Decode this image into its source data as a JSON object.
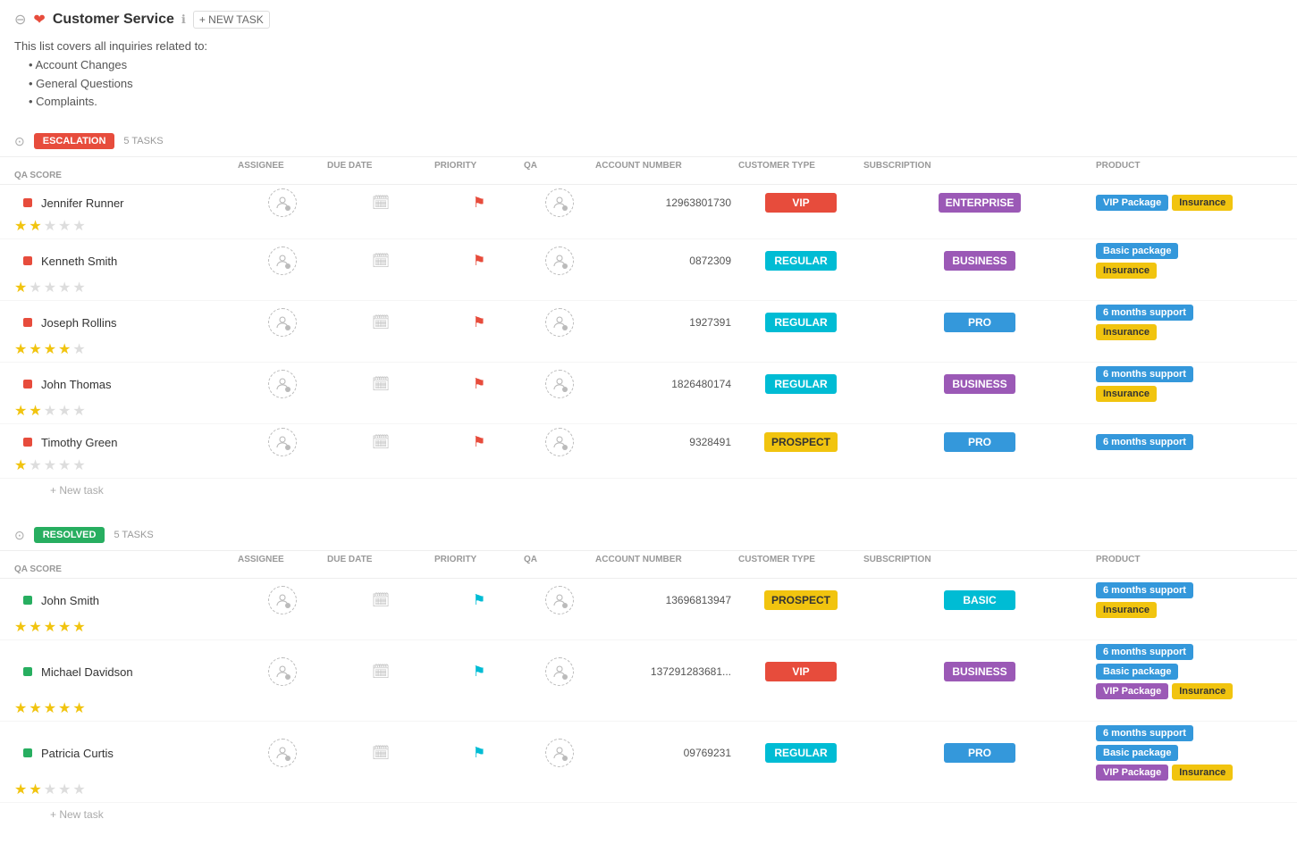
{
  "header": {
    "title": "Customer Service",
    "new_task_label": "+ NEW TASK",
    "info_tooltip": "Info"
  },
  "description": {
    "intro": "This list covers all inquiries related to:",
    "items": [
      "Account Changes",
      "General Questions",
      "Complaints."
    ]
  },
  "sections": [
    {
      "id": "escalation",
      "badge_label": "ESCALATION",
      "badge_class": "badge-escalation",
      "task_count": "5 TASKS",
      "columns": {
        "assignee": "ASSIGNEE",
        "due_date": "DUE DATE",
        "priority": "PRIORITY",
        "qa": "QA",
        "account_number": "ACCOUNT NUMBER",
        "customer_type": "CUSTOMER TYPE",
        "subscription": "SUBSCRIPTION",
        "product": "PRODUCT",
        "qa_score": "QA SCORE"
      },
      "tasks": [
        {
          "name": "Jennifer Runner",
          "account_number": "12963801730",
          "customer_type": "VIP",
          "ct_class": "ct-vip",
          "subscription": "ENTERPRISE",
          "sub_class": "sub-enterprise",
          "products": [
            {
              "label": "VIP Package",
              "class": "tag-blue"
            },
            {
              "label": "Insurance",
              "class": "tag-yellow"
            }
          ],
          "stars": 2,
          "flag_class": "flag-red"
        },
        {
          "name": "Kenneth Smith",
          "account_number": "0872309",
          "customer_type": "REGULAR",
          "ct_class": "ct-regular",
          "subscription": "BUSINESS",
          "sub_class": "sub-business",
          "products": [
            {
              "label": "Basic package",
              "class": "tag-blue"
            },
            {
              "label": "Insurance",
              "class": "tag-yellow"
            }
          ],
          "stars": 1,
          "flag_class": "flag-red"
        },
        {
          "name": "Joseph Rollins",
          "account_number": "1927391",
          "customer_type": "REGULAR",
          "ct_class": "ct-regular",
          "subscription": "PRO",
          "sub_class": "sub-pro",
          "products": [
            {
              "label": "6 months support",
              "class": "tag-blue"
            },
            {
              "label": "Insurance",
              "class": "tag-yellow"
            }
          ],
          "stars": 4,
          "flag_class": "flag-red"
        },
        {
          "name": "John Thomas",
          "account_number": "1826480174",
          "customer_type": "REGULAR",
          "ct_class": "ct-regular",
          "subscription": "BUSINESS",
          "sub_class": "sub-business",
          "products": [
            {
              "label": "6 months support",
              "class": "tag-blue"
            },
            {
              "label": "Insurance",
              "class": "tag-yellow"
            }
          ],
          "stars": 2,
          "flag_class": "flag-red"
        },
        {
          "name": "Timothy Green",
          "account_number": "9328491",
          "customer_type": "PROSPECT",
          "ct_class": "ct-prospect",
          "subscription": "PRO",
          "sub_class": "sub-pro",
          "products": [
            {
              "label": "6 months support",
              "class": "tag-blue"
            }
          ],
          "stars": 1,
          "flag_class": "flag-red"
        }
      ],
      "new_task_label": "+ New task",
      "indicator_class": "indicator-red"
    },
    {
      "id": "resolved",
      "badge_label": "RESOLVED",
      "badge_class": "badge-resolved",
      "task_count": "5 TASKS",
      "columns": {
        "assignee": "ASSIGNEE",
        "due_date": "DUE DATE",
        "priority": "PRIORITY",
        "qa": "QA",
        "account_number": "ACCOUNT NUMBER",
        "customer_type": "CUSTOMER TYPE",
        "subscription": "SUBSCRIPTION",
        "product": "PRODUCT",
        "qa_score": "QA SCORE"
      },
      "tasks": [
        {
          "name": "John Smith",
          "account_number": "13696813947",
          "customer_type": "PROSPECT",
          "ct_class": "ct-prospect",
          "subscription": "BASIC",
          "sub_class": "sub-basic",
          "products": [
            {
              "label": "6 months support",
              "class": "tag-blue"
            },
            {
              "label": "Insurance",
              "class": "tag-yellow"
            }
          ],
          "stars": 5,
          "flag_class": "flag-cyan"
        },
        {
          "name": "Michael Davidson",
          "account_number": "137291283681...",
          "customer_type": "VIP",
          "ct_class": "ct-vip",
          "subscription": "BUSINESS",
          "sub_class": "sub-business",
          "products": [
            {
              "label": "6 months support",
              "class": "tag-blue"
            },
            {
              "label": "Basic package",
              "class": "tag-blue"
            },
            {
              "label": "VIP Package",
              "class": "tag-purple"
            },
            {
              "label": "Insurance",
              "class": "tag-yellow"
            }
          ],
          "stars": 5,
          "flag_class": "flag-cyan"
        },
        {
          "name": "Patricia Curtis",
          "account_number": "09769231",
          "customer_type": "REGULAR",
          "ct_class": "ct-regular",
          "subscription": "PRO",
          "sub_class": "sub-pro",
          "products": [
            {
              "label": "6 months support",
              "class": "tag-blue"
            },
            {
              "label": "Basic package",
              "class": "tag-blue"
            },
            {
              "label": "VIP Package",
              "class": "tag-purple"
            },
            {
              "label": "Insurance",
              "class": "tag-yellow"
            }
          ],
          "stars": 2,
          "flag_class": "flag-cyan"
        }
      ],
      "new_task_label": "+ New task",
      "indicator_class": "indicator-green"
    }
  ]
}
